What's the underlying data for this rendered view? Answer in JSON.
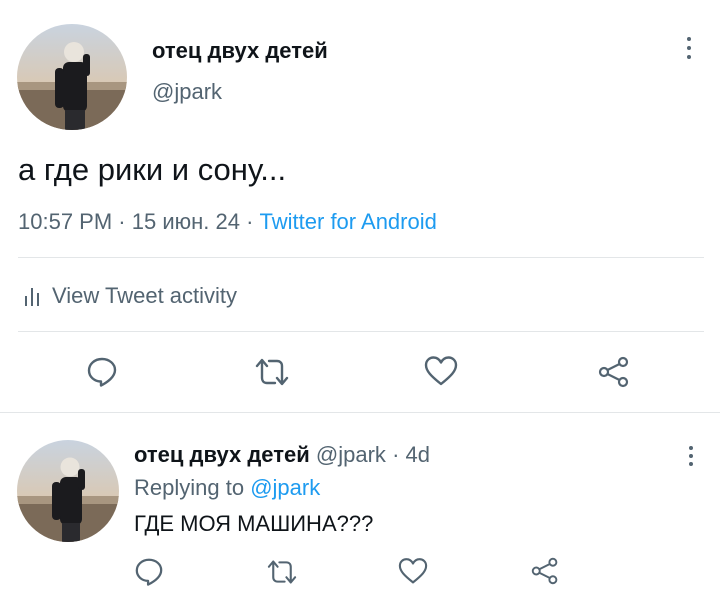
{
  "tweet": {
    "display_name": "отец двух детей",
    "handle": "@jpark",
    "text": "а где рики и сону...",
    "time": "10:57 PM",
    "sep1": "·",
    "date": "15 июн. 24",
    "sep2": "·",
    "source": "Twitter for Android",
    "activity_label": "View Tweet activity"
  },
  "reply": {
    "display_name": "отец двух детей",
    "handle": "@jpark",
    "sep": "·",
    "age": "4d",
    "replying_prefix": "Replying to",
    "replying_to": "@jpark",
    "text": "ГДЕ МОЯ МАШИНА???"
  },
  "colors": {
    "link": "#1d9bf0",
    "muted": "#536471",
    "text": "#0f1419",
    "divider": "#e3e6e8"
  },
  "icons": [
    "more-icon",
    "activity-icon",
    "reply-icon",
    "retweet-icon",
    "like-icon",
    "share-icon"
  ]
}
